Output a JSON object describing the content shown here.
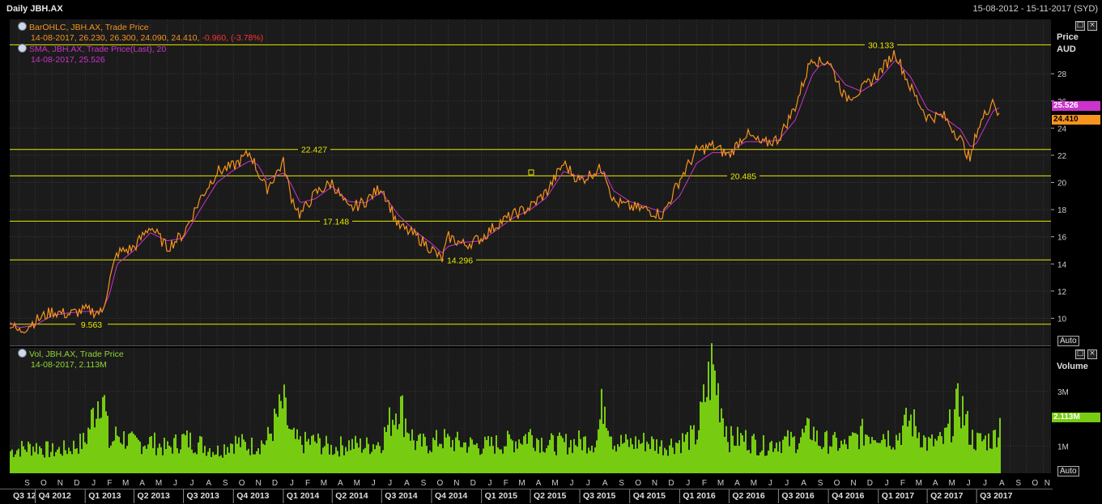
{
  "header": {
    "title": "Daily JBH.AX",
    "date_range": "15-08-2012 - 15-11-2017 (SYD)"
  },
  "legend_price": {
    "ohlc_name": "BarOHLC, JBH.AX, Trade Price",
    "ohlc_values": "14-08-2017, 26.230, 26.300, 24.090, 24.410, ",
    "ohlc_change": "-0.960, (-3.78%)",
    "sma_name": "SMA, JBH.AX, Trade Price(Last),  20",
    "sma_values": "14-08-2017, 25.526"
  },
  "legend_volume": {
    "name": "Vol, JBH.AX, Trade Price",
    "values": "14-08-2017, 2.113M"
  },
  "axis": {
    "price_title": "Price",
    "price_unit": "AUD",
    "volume_title": "Volume",
    "auto_label": "Auto"
  },
  "tags": {
    "sma_last": "25.526",
    "close_last": "24.410",
    "volume_last": "2.113M"
  },
  "colors": {
    "price": "#f7941d",
    "sma": "#cc33cc",
    "volume": "#77cc11",
    "hline": "#e8e800",
    "background": "#000000",
    "panel": "#1b1b1b",
    "grid": "#3a3a3a"
  },
  "icons": [
    "circle-icon",
    "restore-icon",
    "close-icon"
  ],
  "chart_data": {
    "type": "line",
    "instrument": "JBH.AX",
    "x": [
      "2012-08-15",
      "2012-09-01",
      "2012-10-01",
      "2012-11-01",
      "2012-12-01",
      "2013-01-01",
      "2013-02-01",
      "2013-02-15",
      "2013-03-01",
      "2013-04-01",
      "2013-05-01",
      "2013-06-01",
      "2013-07-01",
      "2013-08-01",
      "2013-09-01",
      "2013-10-01",
      "2013-11-01",
      "2013-11-15",
      "2013-12-01",
      "2014-01-01",
      "2014-01-15",
      "2014-02-01",
      "2014-03-01",
      "2014-04-01",
      "2014-05-01",
      "2014-06-01",
      "2014-07-01",
      "2014-08-01",
      "2014-09-01",
      "2014-10-01",
      "2014-10-20",
      "2014-11-01",
      "2014-12-01",
      "2015-01-01",
      "2015-02-01",
      "2015-03-01",
      "2015-04-01",
      "2015-05-01",
      "2015-06-01",
      "2015-07-01",
      "2015-08-01",
      "2015-08-15",
      "2015-09-01",
      "2015-10-01",
      "2015-11-01",
      "2015-12-01",
      "2016-01-01",
      "2016-02-01",
      "2016-03-01",
      "2016-04-01",
      "2016-05-01",
      "2016-06-01",
      "2016-07-01",
      "2016-08-01",
      "2016-09-01",
      "2016-09-15",
      "2016-10-01",
      "2016-11-01",
      "2016-12-01",
      "2017-01-01",
      "2017-02-01",
      "2017-03-01",
      "2017-04-01",
      "2017-05-01",
      "2017-06-01",
      "2017-06-20",
      "2017-07-01",
      "2017-08-01",
      "2017-08-14"
    ],
    "series": [
      {
        "name": "BarOHLC, JBH.AX, Trade Price",
        "values": [
          9.6,
          9.0,
          9.8,
          10.5,
          10.3,
          10.6,
          10.4,
          12.8,
          14.8,
          15.2,
          16.8,
          15.2,
          16.2,
          18.8,
          20.8,
          21.2,
          22.2,
          20.8,
          19.5,
          21.5,
          19.0,
          17.6,
          19.2,
          20.0,
          18.0,
          18.6,
          19.7,
          16.8,
          16.1,
          15.1,
          14.3,
          16.0,
          15.4,
          15.9,
          17.0,
          17.6,
          18.2,
          19.3,
          21.4,
          20.1,
          20.9,
          21.0,
          18.6,
          18.2,
          18.0,
          17.6,
          20.2,
          22.3,
          22.7,
          22.0,
          23.6,
          22.8,
          23.2,
          25.6,
          29.3,
          28.8,
          29.0,
          26.2,
          26.8,
          28.0,
          29.6,
          27.0,
          24.8,
          24.9,
          23.2,
          21.6,
          23.8,
          26.2,
          24.41
        ]
      },
      {
        "name": "SMA, JBH.AX, Trade Price(Last),  20",
        "values": [
          9.7,
          9.3,
          9.5,
          10.2,
          10.4,
          10.5,
          10.5,
          11.8,
          14.0,
          15.0,
          16.3,
          15.7,
          15.9,
          18.0,
          20.0,
          20.9,
          21.6,
          21.3,
          20.2,
          20.7,
          19.9,
          18.5,
          18.8,
          19.7,
          18.6,
          18.5,
          19.3,
          17.6,
          16.4,
          15.5,
          14.8,
          15.3,
          15.6,
          15.7,
          16.6,
          17.4,
          18.0,
          18.9,
          20.8,
          20.4,
          20.6,
          20.8,
          19.4,
          18.6,
          18.2,
          17.8,
          19.0,
          21.4,
          22.2,
          22.2,
          23.0,
          23.0,
          23.1,
          24.6,
          27.9,
          28.6,
          28.8,
          27.2,
          26.7,
          27.5,
          29.0,
          27.8,
          25.4,
          24.8,
          23.9,
          22.6,
          22.9,
          25.3,
          25.526
        ]
      }
    ],
    "volume_values": [
      0.9,
      1.0,
      1.1,
      0.9,
      1.0,
      1.3,
      3.6,
      1.1,
      1.6,
      1.2,
      1.3,
      1.0,
      1.4,
      1.2,
      0.9,
      1.3,
      1.1,
      1.2,
      1.3,
      2.8,
      1.5,
      1.2,
      1.3,
      1.0,
      1.2,
      1.1,
      1.3,
      2.9,
      1.2,
      1.2,
      1.4,
      1.3,
      1.2,
      1.1,
      1.2,
      1.3,
      1.6,
      1.2,
      1.2,
      1.3,
      1.3,
      3.2,
      1.3,
      1.2,
      1.3,
      1.1,
      1.3,
      1.5,
      4.4,
      1.4,
      1.4,
      1.1,
      1.3,
      1.3,
      1.8,
      1.2,
      1.3,
      1.1,
      1.6,
      1.7,
      1.4,
      2.2,
      1.2,
      1.3,
      2.9,
      1.5,
      1.3,
      1.4,
      2.113
    ],
    "price_levels": [
      9.563,
      14.296,
      17.148,
      20.485,
      22.427,
      30.133
    ],
    "ylim": [
      8,
      32
    ],
    "y_ticks": [
      10,
      12,
      14,
      16,
      18,
      20,
      22,
      24,
      26,
      28
    ],
    "volume_ylim": [
      0,
      4.6
    ],
    "volume_ticks": [
      "1M",
      "3M"
    ],
    "volume_tick_values": [
      1,
      3
    ],
    "month_labels": [
      "S",
      "O",
      "N",
      "D",
      "J",
      "F",
      "M",
      "A",
      "M",
      "J",
      "J",
      "A",
      "S",
      "O",
      "N",
      "D",
      "J",
      "F",
      "M",
      "A",
      "M",
      "J",
      "J",
      "A",
      "S",
      "O",
      "N",
      "D",
      "J",
      "F",
      "M",
      "A",
      "M",
      "J",
      "J",
      "A",
      "S",
      "O",
      "N",
      "D",
      "J",
      "F",
      "M",
      "A",
      "M",
      "J",
      "J",
      "A",
      "S",
      "O",
      "N",
      "D",
      "J",
      "F",
      "M",
      "A",
      "M",
      "J",
      "J",
      "A",
      "S",
      "O",
      "N"
    ],
    "quarter_labels": [
      "Q3 12",
      "Q4 2012",
      "Q1 2013",
      "Q2 2013",
      "Q3 2013",
      "Q4 2013",
      "Q1 2014",
      "Q2 2014",
      "Q3 2014",
      "Q4 2014",
      "Q1 2015",
      "Q2 2015",
      "Q3 2015",
      "Q4 2015",
      "Q1 2016",
      "Q2 2016",
      "Q3 2016",
      "Q4 2016",
      "Q1 2017",
      "Q2 2017",
      "Q3 2017"
    ],
    "grid": true
  }
}
